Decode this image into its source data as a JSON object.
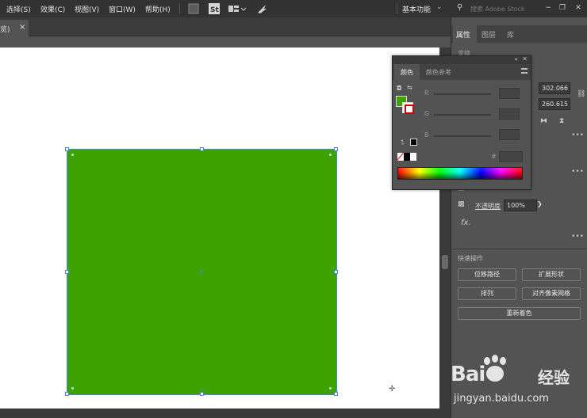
{
  "menubar": {
    "items": [
      "选择(S)",
      "效果(C)",
      "视图(V)",
      "窗口(W)",
      "帮助(H)"
    ],
    "workspace": "基本功能",
    "stock_search_placeholder": "搜索 Adobe Stock"
  },
  "doc_tab": {
    "title": "览)",
    "close": "×"
  },
  "right_panel": {
    "tabs": [
      "属性",
      "图层",
      "库"
    ],
    "section_label": "变换",
    "x_value": "302.066",
    "y_value": "260.615",
    "opacity_label": "不透明度",
    "opacity_value": "100%",
    "fx": "fx.",
    "quick_actions_label": "快速操作",
    "quick_actions": [
      "位移路径",
      "扩展形状",
      "排列",
      "对齐像素网格",
      "重新着色"
    ]
  },
  "color_panel": {
    "tabs": [
      "颜色",
      "颜色参考"
    ],
    "channels": [
      "R",
      "G",
      "B"
    ],
    "hex_label": "#",
    "fill_color": "#3ea300"
  },
  "watermark": {
    "brand": "Bai",
    "jingyan": "经验",
    "url": "jingyan.baidu.com"
  },
  "colors": {
    "shape_fill": "#3ea300",
    "selection": "#4d85d6",
    "ui_dark": "#323232",
    "ui_panel": "#535353"
  }
}
